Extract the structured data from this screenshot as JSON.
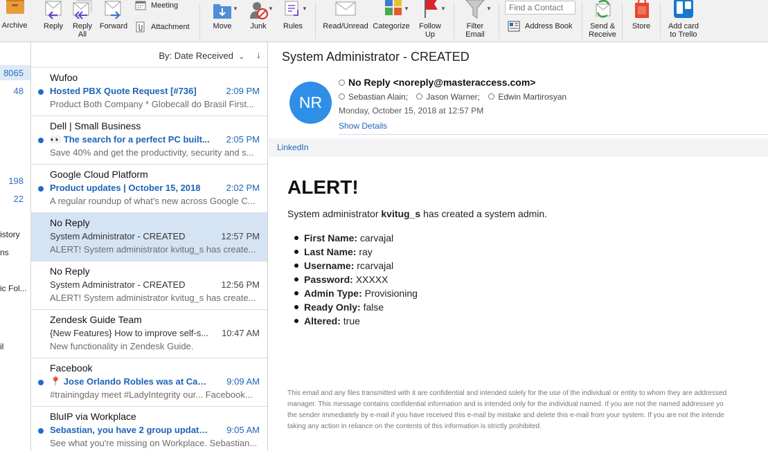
{
  "toolbar": {
    "archive": "Archive",
    "reply": "Reply",
    "reply_all_1": "Reply",
    "reply_all_2": "All",
    "forward": "Forward",
    "meeting": "Meeting",
    "attachment": "Attachment",
    "move": "Move",
    "junk": "Junk",
    "rules": "Rules",
    "read_unread": "Read/Unread",
    "categorize": "Categorize",
    "follow_up_1": "Follow",
    "follow_up_2": "Up",
    "filter_email_1": "Filter",
    "filter_email_2": "Email",
    "find_contact_placeholder": "Find a Contact",
    "address_book": "Address Book",
    "send_receive_1": "Send &",
    "send_receive_2": "Receive",
    "store": "Store",
    "add_card_1": "Add card",
    "add_card_2": "to Trello"
  },
  "folders": {
    "count_1": "8065",
    "count_2": "48",
    "count_3": "198",
    "count_4": "22",
    "name_1": "istory",
    "name_2": "ns",
    "name_3": "ic Fol...",
    "name_4": "il"
  },
  "message_list": {
    "sort_label": "By: Date Received",
    "messages": [
      {
        "sender": "Wufoo",
        "subject": "Hosted PBX Quote Request [#736]",
        "time": "2:09 PM",
        "preview": "Product Both Company * Globecall do Brasil First..."
      },
      {
        "sender": "Dell | Small Business",
        "subject": "👀 The search for a perfect PC built...",
        "time": "2:05 PM",
        "preview": "Save 40% and get the productivity, security and s..."
      },
      {
        "sender": "Google Cloud Platform",
        "subject": "Product updates | October 15, 2018",
        "time": "2:02 PM",
        "preview": "A regular roundup of what's new across Google C..."
      },
      {
        "sender": "No Reply",
        "subject": "System Administrator - CREATED",
        "time": "12:57 PM",
        "preview": "ALERT! System administrator kvitug_s has create..."
      },
      {
        "sender": "No Reply",
        "subject": "System Administrator - CREATED",
        "time": "12:56 PM",
        "preview": "ALERT! System administrator kvitug_s has create..."
      },
      {
        "sender": "Zendesk Guide Team",
        "subject": "{New Features} How to improve self-s...",
        "time": "10:47 AM",
        "preview": "New functionality in Zendesk Guide."
      },
      {
        "sender": "Facebook",
        "subject": "📍 Jose Orlando Robles was at Capi...",
        "time": "9:09 AM",
        "preview": "#trainingday meet #LadyIntegrity our... Facebook..."
      },
      {
        "sender": "BluIP via Workplace",
        "subject": "Sebastian, you have 2 group update...",
        "time": "9:05 AM",
        "preview": "See what you're missing on Workplace. Sebastian..."
      }
    ]
  },
  "reading_pane": {
    "subject": "System Administrator - CREATED",
    "avatar_initials": "NR",
    "from": "No Reply <noreply@masteraccess.com>",
    "recipients": [
      "Sebastian Alain;",
      "Jason Warner;",
      "Edwin Martirosyan"
    ],
    "date": "Monday, October 15, 2018 at 12:57 PM",
    "show_details": "Show Details",
    "link_label": "LinkedIn",
    "body": {
      "title": "ALERT!",
      "intro_before": "System administrator ",
      "intro_user": "kvitug_s",
      "intro_after": " has created a system admin.",
      "fields": [
        {
          "label": "First Name:",
          "value": " carvajal"
        },
        {
          "label": "Last Name:",
          "value": " ray"
        },
        {
          "label": "Username:",
          "value": " rcarvajal"
        },
        {
          "label": "Password:",
          "value": " XXXXX"
        },
        {
          "label": "Admin Type:",
          "value": " Provisioning"
        },
        {
          "label": "Ready Only:",
          "value": " false"
        },
        {
          "label": "Altered:",
          "value": " true"
        }
      ],
      "disclaimer": [
        "This email and any files transmitted with it are confidential and intended solely for the use of the individual or entity to whom they are addressed",
        "manager. This message contains confidential information and is intended only for the individual named. If you are not the named addressee yo",
        "the sender immediately by e-mail if you have received this e-mail by mistake and delete this e-mail from your system. If you are not the intende",
        "taking any action in reliance on the contents of this information is strictly prohibited."
      ]
    }
  },
  "colors": {
    "accent_blue": "#1d63b8",
    "unread_dot": "#1f6bd1",
    "selected_row": "#d4e4f5",
    "avatar": "#2f8ee5"
  }
}
